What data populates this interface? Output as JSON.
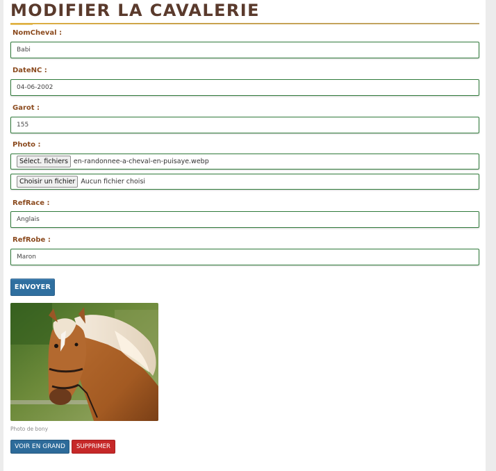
{
  "page": {
    "title": "MODIFIER LA CAVALERIE"
  },
  "form": {
    "nom_cheval": {
      "label": "NomCheval :",
      "value": "Babi"
    },
    "date_nc": {
      "label": "DateNC :",
      "value": "04-06-2002"
    },
    "garot": {
      "label": "Garot :",
      "value": "155"
    },
    "photo": {
      "label": "Photo :",
      "file1": {
        "button": "Sélect. fichiers",
        "filename": "en-randonnee-a-cheval-en-puisaye.webp"
      },
      "file2": {
        "button": "Choisir un fichier",
        "filename": "Aucun fichier choisi"
      }
    },
    "ref_race": {
      "label": "RefRace :",
      "value": "Anglais"
    },
    "ref_robe": {
      "label": "RefRobe :",
      "value": "Maron"
    },
    "submit_label": "ENVOYER"
  },
  "preview": {
    "caption": "Photo de bony",
    "view_label": "VOIR EN GRAND",
    "delete_label": "SUPPRIMER"
  },
  "colors": {
    "title": "#5a3a2c",
    "label": "#8b4a1e",
    "field_border": "#2f7a3a",
    "primary_button": "#2f6f9f",
    "danger_button": "#c62828"
  }
}
